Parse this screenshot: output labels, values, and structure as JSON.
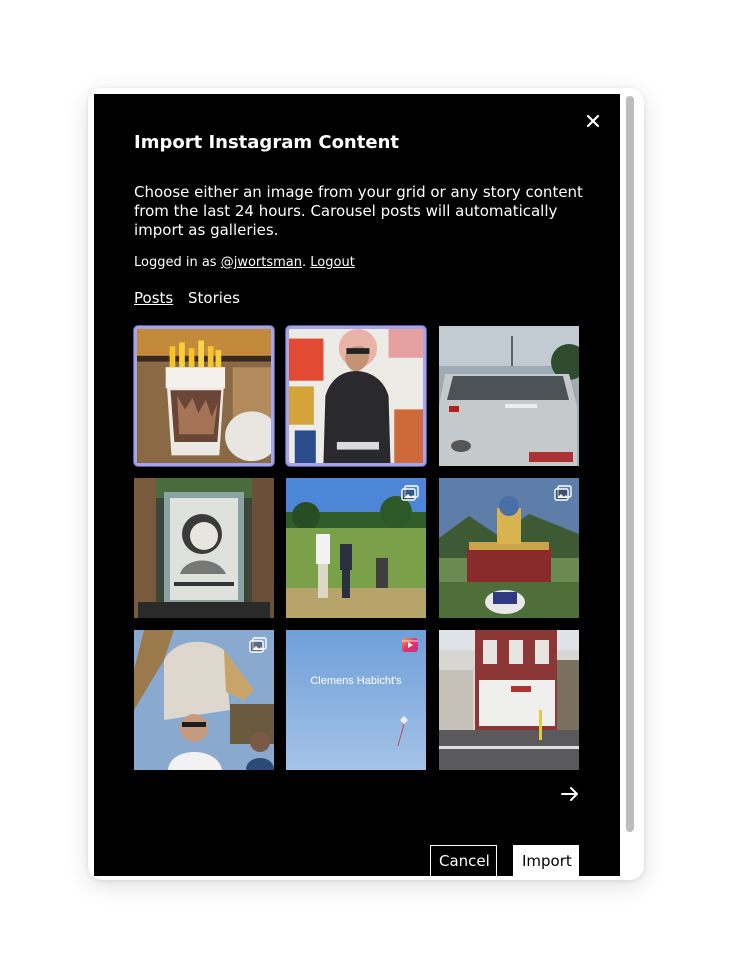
{
  "dialog": {
    "title": "Import Instagram Content",
    "description": "Choose either an image from your grid or any story content from the last 24 hours. Carousel posts will automatically import as galleries.",
    "login": {
      "prefix": "Logged in as ",
      "username": "@jwortsman",
      "separator": ". ",
      "logout_label": "Logout"
    },
    "tabs": [
      {
        "label": "Posts",
        "active": true
      },
      {
        "label": "Stories",
        "active": false
      }
    ],
    "grid": [
      {
        "subject": "fries cup",
        "selected": true,
        "badge": ""
      },
      {
        "subject": "man portrait",
        "selected": true,
        "badge": ""
      },
      {
        "subject": "car in parking lot",
        "selected": false,
        "badge": ""
      },
      {
        "subject": "street poster",
        "selected": false,
        "badge": ""
      },
      {
        "subject": "park golf",
        "selected": false,
        "badge": "carousel-icon"
      },
      {
        "subject": "temple statue",
        "selected": false,
        "badge": "carousel-icon"
      },
      {
        "subject": "temple selfie",
        "selected": false,
        "badge": "carousel-icon"
      },
      {
        "subject": "sky kite reel",
        "selected": false,
        "badge": "reel-icon",
        "overlay_text": "Clemens Habicht's"
      },
      {
        "subject": "corner building",
        "selected": false,
        "badge": ""
      }
    ],
    "buttons": {
      "cancel_label": "Cancel",
      "import_label": "Import"
    },
    "colors": {
      "background": "#000000",
      "text": "#ffffff",
      "selection": "#a6a4e8",
      "import_button_bg": "#ffffff"
    }
  }
}
